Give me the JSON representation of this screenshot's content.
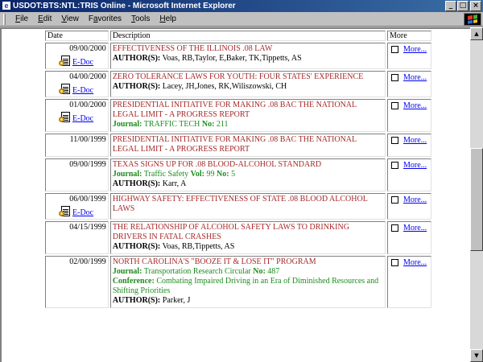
{
  "window": {
    "title": "USDOT:BTS:NTL:TRIS Online - Microsoft Internet Explorer",
    "app_icon": "ie-page-icon",
    "buttons": [
      "_",
      "□",
      "×"
    ]
  },
  "menu": {
    "items": [
      {
        "u": "F",
        "rest": "ile"
      },
      {
        "u": "E",
        "rest": "dit"
      },
      {
        "u": "V",
        "rest": "iew"
      },
      {
        "u": "",
        "rest": "Favorites",
        "u_index": 1
      },
      {
        "u": "T",
        "rest": "ools"
      },
      {
        "u": "H",
        "rest": "elp"
      }
    ],
    "favorites_label": "Favorites"
  },
  "table": {
    "headers": {
      "date": "Date",
      "description": "Description",
      "more": "More"
    },
    "more_label": "More...",
    "edoc_label": "E-Doc",
    "author_label": "AUTHOR(S):",
    "journal_label": "Journal:",
    "no_label": "No:",
    "vol_label": "Vol:",
    "conference_label": "Conference:",
    "rows": [
      {
        "date": "09/00/2000",
        "edoc": true,
        "title": "EFFECTIVENESS OF THE ILLINOIS .08 LAW",
        "authors": "Voas, RB,Taylor, E,Baker, TK,Tippetts, AS"
      },
      {
        "date": "04/00/2000",
        "edoc": true,
        "title": "ZERO TOLERANCE LAWS FOR YOUTH: FOUR STATES' EXPERIENCE",
        "authors": "Lacey, JH,Jones, RK,Wiliszowski, CH"
      },
      {
        "date": "01/00/2000",
        "edoc": true,
        "title": "PRESIDENTIAL INITIATIVE FOR MAKING .08 BAC THE NATIONAL LEGAL LIMIT - A PROGRESS REPORT",
        "journal": "TRAFFIC TECH",
        "journal_no": "211"
      },
      {
        "date": "11/00/1999",
        "edoc": false,
        "title": "PRESIDENTIAL INITIATIVE FOR MAKING .08 BAC THE NATIONAL LEGAL LIMIT - A PROGRESS REPORT"
      },
      {
        "date": "09/00/1999",
        "edoc": false,
        "title": "TEXAS SIGNS UP FOR .08 BLOOD-ALCOHOL STANDARD",
        "journal": "Traffic Safety",
        "journal_vol": "99",
        "journal_no": "5",
        "authors": "Karr, A"
      },
      {
        "date": "06/00/1999",
        "edoc": true,
        "title": "HIGHWAY SAFETY: EFFECTIVENESS OF STATE .08 BLOOD ALCOHOL LAWS"
      },
      {
        "date": "04/15/1999",
        "edoc": false,
        "title": "THE RELATIONSHIP OF ALCOHOL SAFETY LAWS TO DRINKING DRIVERS IN FATAL CRASHES",
        "authors": "Voas, RB,Tippetts, AS"
      },
      {
        "date": "02/00/1999",
        "edoc": false,
        "title": "NORTH CAROLINA'S \"BOOZE IT & LOSE IT\" PROGRAM",
        "journal": "Transportation Research Circular",
        "journal_no": "487",
        "conference": "Combating Impaired Driving in an Era of Diminished Resources and Shifting Priorities",
        "authors": "Parker, J"
      }
    ]
  },
  "colors": {
    "title_text": "#a52a2a",
    "journal_text": "#1c8c1c",
    "link": "#0000ee",
    "titlebar_start": "#0a246a",
    "titlebar_end": "#3a6ea5"
  }
}
